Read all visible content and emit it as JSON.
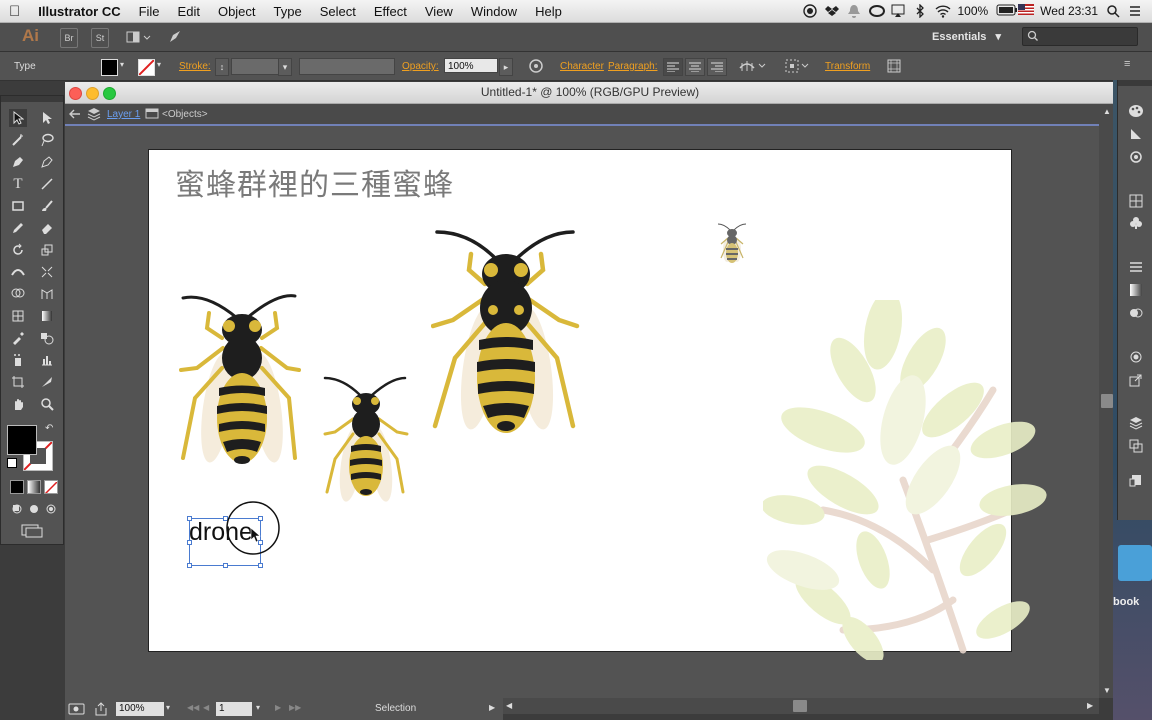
{
  "menubar": {
    "app_name": "Illustrator CC",
    "items": [
      "File",
      "Edit",
      "Object",
      "Type",
      "Select",
      "Effect",
      "View",
      "Window",
      "Help"
    ],
    "battery": "100%",
    "clock": "Wed 23:31"
  },
  "appbar": {
    "logo": "Ai",
    "bridge": "Br",
    "stock": "St",
    "workspace": "Essentials"
  },
  "control": {
    "mode": "Type",
    "stroke_label": "Stroke:",
    "opacity_label": "Opacity:",
    "opacity_value": "100%",
    "character_link": "Character",
    "paragraph_link": "Paragraph:",
    "transform_link": "Transform"
  },
  "document": {
    "title": "Untitled-1* @ 100% (RGB/GPU Preview)",
    "layer": "Layer 1",
    "objects": "<Objects>"
  },
  "artboard": {
    "title": "蜜蜂群裡的三種蜜蜂",
    "text_object": "drone"
  },
  "status": {
    "zoom": "100%",
    "page": "1",
    "tool": "Selection"
  },
  "dock": {
    "book_label": "book"
  },
  "colors": {
    "bee_yellow": "#d9b83a",
    "bee_black": "#1e1e1e",
    "leaf": "#e8edc4"
  }
}
